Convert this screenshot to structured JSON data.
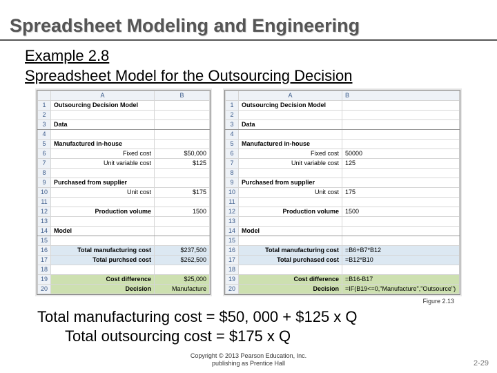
{
  "title": "Spreadsheet Modeling and Engineering",
  "subtitle_line1": "Example 2.8",
  "subtitle_line2": "Spreadsheet Model for the Outsourcing Decision",
  "sheet_left": {
    "colA": "A",
    "colB": "B",
    "r1A": "Outsourcing Decision Model",
    "r3A": "Data",
    "r5A": "Manufactured in-house",
    "r6A": "Fixed cost",
    "r6B": "$50,000",
    "r7A": "Unit variable cost",
    "r7B": "$125",
    "r9A": "Purchased from supplier",
    "r10A": "Unit cost",
    "r10B": "$175",
    "r12A": "Production volume",
    "r12B": "1500",
    "r14A": "Model",
    "r16A": "Total manufacturing cost",
    "r16B": "$237,500",
    "r17A": "Total purchsed cost",
    "r17B": "$262,500",
    "r19A": "Cost difference",
    "r19B": "$25,000",
    "r20A": "Decision",
    "r20B": "Manufacture"
  },
  "sheet_right": {
    "colA": "A",
    "colB": "B",
    "r1A": "Outsourcing Decision Model",
    "r3A": "Data",
    "r5A": "Manufactured in-house",
    "r6A": "Fixed cost",
    "r6B": "50000",
    "r7A": "Unit variable cost",
    "r7B": "125",
    "r9A": "Purchased from supplier",
    "r10A": "Unit cost",
    "r10B": "175",
    "r12A": "Production volume",
    "r12B": "1500",
    "r14A": "Model",
    "r16A": "Total manufacturing cost",
    "r16B": "=B6+B7*B12",
    "r17A": "Total purchased cost",
    "r17B": "=B12*B10",
    "r19A": "Cost difference",
    "r19B": "=B16-B17",
    "r20A": "Decision",
    "r20B": "=IF(B19<=0,\"Manufacture\",\"Outsource\")"
  },
  "figure_label": "Figure 2.13",
  "formula1": "Total manufacturing cost = $50, 000 + $125 x Q",
  "formula2": "Total outsourcing cost = $175 x Q",
  "copyright_line1": "Copyright © 2013 Pearson Education, Inc.",
  "copyright_line2": "publishing as Prentice Hall",
  "page_num": "2-29"
}
